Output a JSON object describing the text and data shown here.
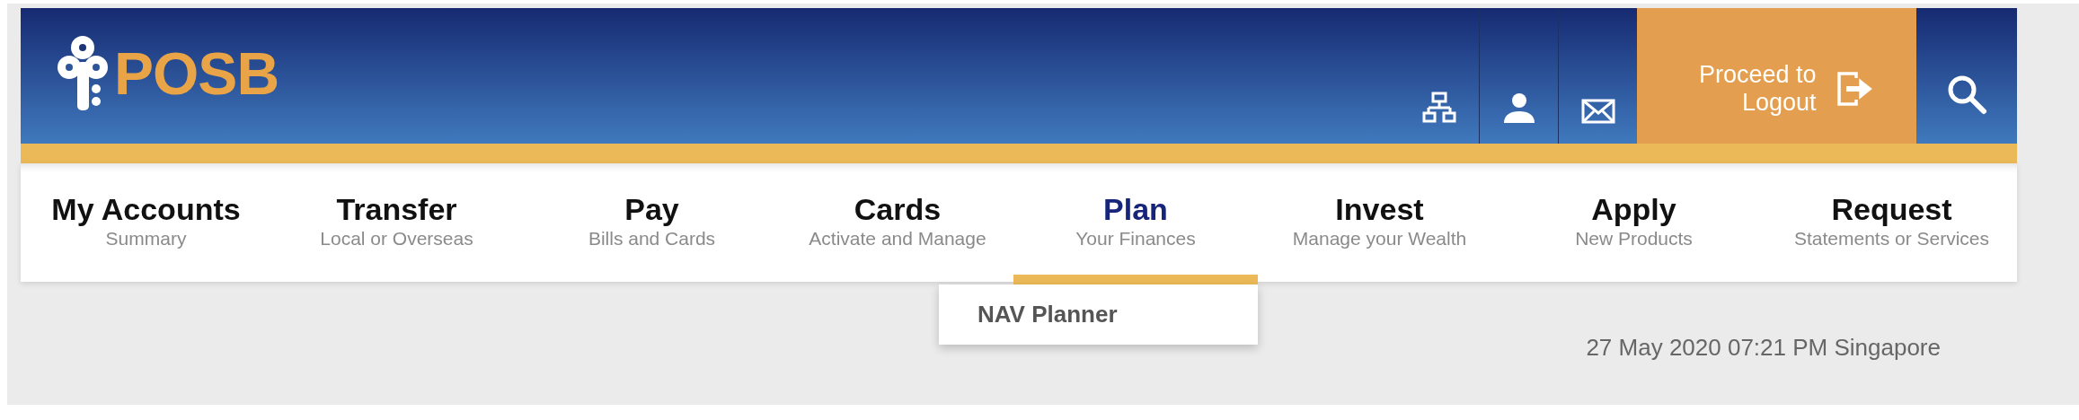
{
  "header": {
    "logo": "POSB",
    "icons": [
      {
        "kind": "sitemap"
      },
      {
        "kind": "user"
      },
      {
        "kind": "mail"
      }
    ],
    "logout": {
      "label": "Proceed to Logout"
    },
    "search": {
      "kind": "search"
    }
  },
  "nav": [
    {
      "title": "My Accounts",
      "subtitle": "Summary",
      "selected": false
    },
    {
      "title": "Transfer",
      "subtitle": "Local or Overseas",
      "selected": false
    },
    {
      "title": "Pay",
      "subtitle": "Bills and Cards",
      "selected": false
    },
    {
      "title": "Cards",
      "subtitle": "Activate and Manage",
      "selected": false
    },
    {
      "title": "Plan",
      "subtitle": "Your Finances",
      "selected": true,
      "menu": [
        "NAV Planner"
      ]
    },
    {
      "title": "Invest",
      "subtitle": "Manage your Wealth",
      "selected": false
    },
    {
      "title": "Apply",
      "subtitle": "New Products",
      "selected": false
    },
    {
      "title": "Request",
      "subtitle": "Statements or Services",
      "selected": false
    }
  ],
  "timestamp": "27 May 2020 07:21 PM Singapore"
}
